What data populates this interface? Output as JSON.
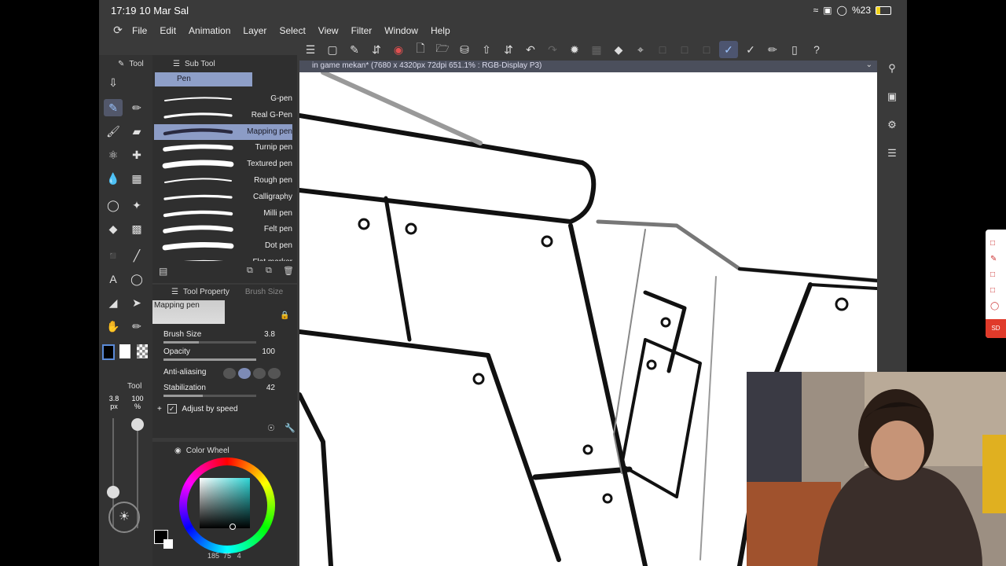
{
  "statusbar": {
    "time": "17:19  10 Mar Sal",
    "battery": "%23"
  },
  "menubar": {
    "items": [
      "File",
      "Edit",
      "Animation",
      "Layer",
      "Select",
      "View",
      "Filter",
      "Window",
      "Help"
    ]
  },
  "document_tab": {
    "title": "in game mekan* (7680 x 4320px 72dpi 651.1% : RGB-Display P3)"
  },
  "panels": {
    "tool": "Tool",
    "sub_tool": "Sub Tool",
    "sub_tool_group": "Pen",
    "tool_property": "Tool Property",
    "brush_size_tab": "Brush Size",
    "tool_preview": "Mapping pen",
    "color_wheel": "Color Wheel",
    "tool2": "Tool"
  },
  "pens": [
    {
      "name": "G-pen",
      "selected": false
    },
    {
      "name": "Real G-Pen",
      "selected": false
    },
    {
      "name": "Mapping pen",
      "selected": true
    },
    {
      "name": "Turnip pen",
      "selected": false
    },
    {
      "name": "Textured pen",
      "selected": false
    },
    {
      "name": "Rough pen",
      "selected": false
    },
    {
      "name": "Calligraphy",
      "selected": false
    },
    {
      "name": "Milli pen",
      "selected": false
    },
    {
      "name": "Felt pen",
      "selected": false
    },
    {
      "name": "Dot pen",
      "selected": false
    },
    {
      "name": "Flat marker",
      "selected": false
    }
  ],
  "properties": {
    "brush_size_label": "Brush Size",
    "brush_size_value": "3.8",
    "brush_size_fraction": 0.38,
    "opacity_label": "Opacity",
    "opacity_value": "100",
    "opacity_fraction": 1.0,
    "antialiasing_label": "Anti-aliasing",
    "stabilization_label": "Stabilization",
    "stabilization_value": "42",
    "stabilization_fraction": 0.42,
    "adjust_by_speed_label": "Adjust by speed"
  },
  "brush_indicator": {
    "size": "3.8",
    "unit": "px",
    "opacity": "100",
    "opacity_unit": "%"
  },
  "color": {
    "main": "#000000",
    "sub": "#ffffff",
    "accent": "#2fd6d6",
    "readout_a": "185",
    "readout_b": "75",
    "readout_c": "4"
  }
}
